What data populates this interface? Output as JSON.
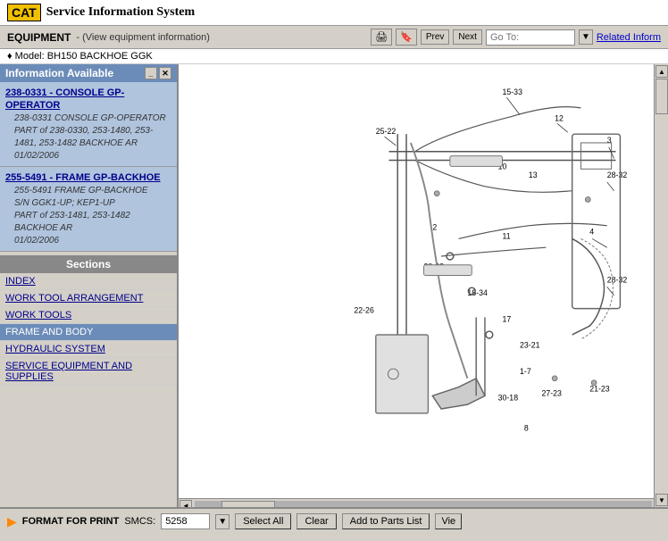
{
  "header": {
    "cat_label": "CAT",
    "title": "Service Information System"
  },
  "toolbar": {
    "equipment_label": "EQUIPMENT",
    "view_info": "- (View equipment information)",
    "prev_label": "Prev",
    "next_label": "Next",
    "goto_placeholder": "Go To:",
    "goto_value": "",
    "related_label": "Related Inform"
  },
  "model_row": {
    "prefix": "♦ Model:",
    "model": "BH150 BACKHOE GGK"
  },
  "left_panel": {
    "header": "Information Available",
    "items": [
      {
        "id": "item1",
        "link": "238-0331 - CONSOLE GP-OPERATOR",
        "detail": "238-0331 CONSOLE GP-OPERATOR\nPART of 238-0330, 253-1480, 253-1481, 253-1482 BACKHOE AR\n01/02/2006"
      },
      {
        "id": "item2",
        "link": "255-5491 - FRAME GP-BACKHOE",
        "detail": "255-5491 FRAME GP-BACKHOE\nS/N GGK1-UP; KEP1-UP\nPART of 253-1481, 253-1482 BACKHOE AR\n01/02/2006"
      }
    ],
    "sections_header": "Sections",
    "nav_items": [
      {
        "id": "index",
        "label": "INDEX",
        "active": false
      },
      {
        "id": "work-tool-arr",
        "label": "WORK TOOL ARRANGEMENT",
        "active": false
      },
      {
        "id": "work-tools",
        "label": "WORK TOOLS",
        "active": false
      },
      {
        "id": "frame-body",
        "label": "FRAME AND BODY",
        "active": true
      },
      {
        "id": "hydraulic",
        "label": "HYDRAULIC SYSTEM",
        "active": false
      },
      {
        "id": "service-equip",
        "label": "SERVICE EQUIPMENT AND SUPPLIES",
        "active": false
      }
    ]
  },
  "diagram": {
    "labels": [
      "15-33",
      "12",
      "3",
      "25-22",
      "10",
      "13",
      "28-32",
      "2",
      "11",
      "20-32",
      "18-34",
      "28-32",
      "22-26",
      "17",
      "23-21",
      "1-7",
      "14",
      "30-18",
      "27-23",
      "21-23",
      "4",
      "8"
    ]
  },
  "bottom_bar": {
    "format_label": "FORMAT FOR PRINT",
    "smcs_label": "SMCS:",
    "smcs_value": "5258",
    "select_all_label": "Select All",
    "clear_label": "Clear",
    "add_to_parts_label": "Add to Parts List",
    "view_label": "Vie"
  }
}
